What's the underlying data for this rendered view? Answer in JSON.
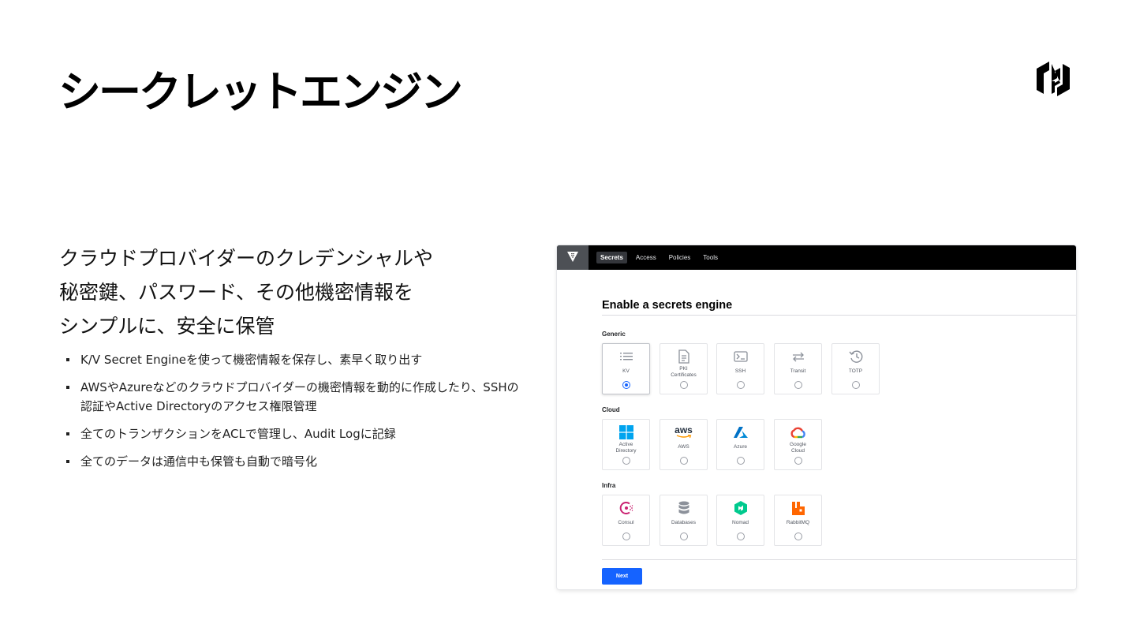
{
  "slide": {
    "title": "シークレットエンジン",
    "lead_lines": [
      "クラウドプロバイダーのクレデンシャルや",
      "秘密鍵、パスワード、その他機密情報を",
      "シンプルに、安全に保管"
    ],
    "bullets": [
      "K/V Secret Engineを使って機密情報を保存し、素早く取り出す",
      "AWSやAzureなどのクラウドプロバイダーの機密情報を動的に作成したり、SSHの認証やActive Directoryのアクセス権限管理",
      "全てのトランザクションをACLで管理し、Audit Logに記録",
      "全てのデータは通信中も保管も自動で暗号化"
    ]
  },
  "vault": {
    "nav": [
      "Secrets",
      "Access",
      "Policies",
      "Tools"
    ],
    "active_nav": "Secrets",
    "page_title": "Enable a secrets engine",
    "groups": [
      {
        "label": "Generic",
        "items": [
          {
            "label": "KV",
            "icon": "list-icon",
            "selected": true
          },
          {
            "label": "PKI Certificates",
            "icon": "document-icon",
            "selected": false
          },
          {
            "label": "SSH",
            "icon": "terminal-icon",
            "selected": false
          },
          {
            "label": "Transit",
            "icon": "swap-arrows-icon",
            "selected": false
          },
          {
            "label": "TOTP",
            "icon": "history-clock-icon",
            "selected": false
          }
        ]
      },
      {
        "label": "Cloud",
        "items": [
          {
            "label": "Active Directory",
            "icon": "windows-logo-icon",
            "selected": false
          },
          {
            "label": "AWS",
            "icon": "aws-logo-icon",
            "selected": false
          },
          {
            "label": "Azure",
            "icon": "azure-logo-icon",
            "selected": false
          },
          {
            "label": "Google Cloud",
            "icon": "google-cloud-logo-icon",
            "selected": false
          }
        ]
      },
      {
        "label": "Infra",
        "items": [
          {
            "label": "Consul",
            "icon": "consul-logo-icon",
            "selected": false
          },
          {
            "label": "Databases",
            "icon": "database-icon",
            "selected": false
          },
          {
            "label": "Nomad",
            "icon": "nomad-logo-icon",
            "selected": false
          },
          {
            "label": "RabbitMQ",
            "icon": "rabbitmq-logo-icon",
            "selected": false
          }
        ]
      }
    ],
    "aws_wordmark": "aws",
    "next_label": "Next",
    "colors": {
      "primary_blue": "#1563ff",
      "windows_blue": "#00a4ef",
      "azure_blue": "#0072c6",
      "consul_pink": "#ca2171",
      "nomad_green": "#00ca8e",
      "rabbitmq_orange": "#ff6600",
      "aws_orange": "#ff9900"
    }
  }
}
